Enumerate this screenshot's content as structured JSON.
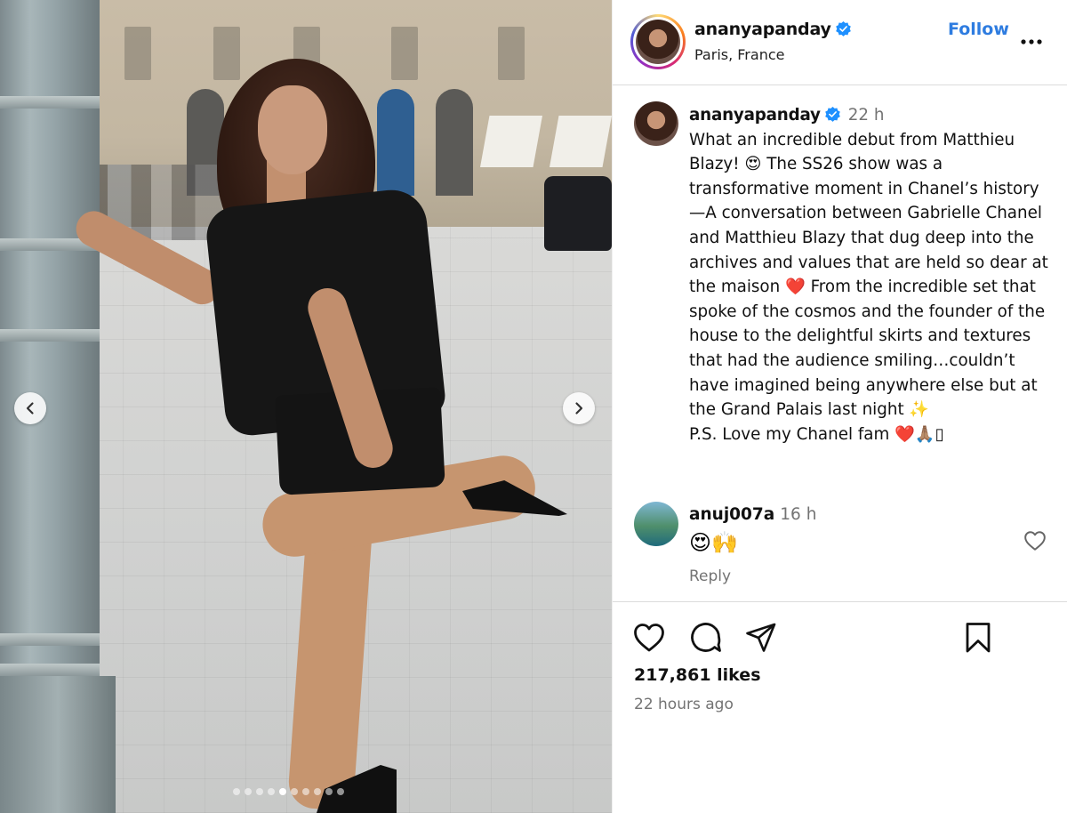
{
  "post": {
    "username": "ananyapanday",
    "location": "Paris, France",
    "follow_label": "Follow",
    "caption_time": "22 h",
    "caption": "What an incredible debut from Matthieu Blazy! 😍 The SS26 show was a transformative moment in Chanel’s history—A conversation between Gabrielle Chanel and Matthieu Blazy that dug deep into the archives and values that are held so dear at the maison ❤️ From the incredible set that spoke of the cosmos and the founder of the house to the delightful skirts and textures that had the audience smiling…couldn’t have imagined being anywhere else but at the Grand Palais last night ✨\nP.S. Love my Chanel fam ❤️🙏🏽▯",
    "likes": "217,861 likes",
    "posted_ago": "22 hours ago"
  },
  "comment": {
    "username": "anuj007a",
    "time": "16 h",
    "text": "😍🙌",
    "reply_label": "Reply"
  },
  "carousel": {
    "total": 10,
    "active_index": 4
  },
  "colors": {
    "follow": "#2e7ce0",
    "verified": "#1e90ff",
    "muted": "#737373"
  },
  "icons": [
    "verified-badge-icon",
    "more-options-icon",
    "like-heart-icon",
    "comment-icon",
    "share-icon",
    "save-bookmark-icon",
    "chevron-left-icon",
    "chevron-right-icon"
  ]
}
